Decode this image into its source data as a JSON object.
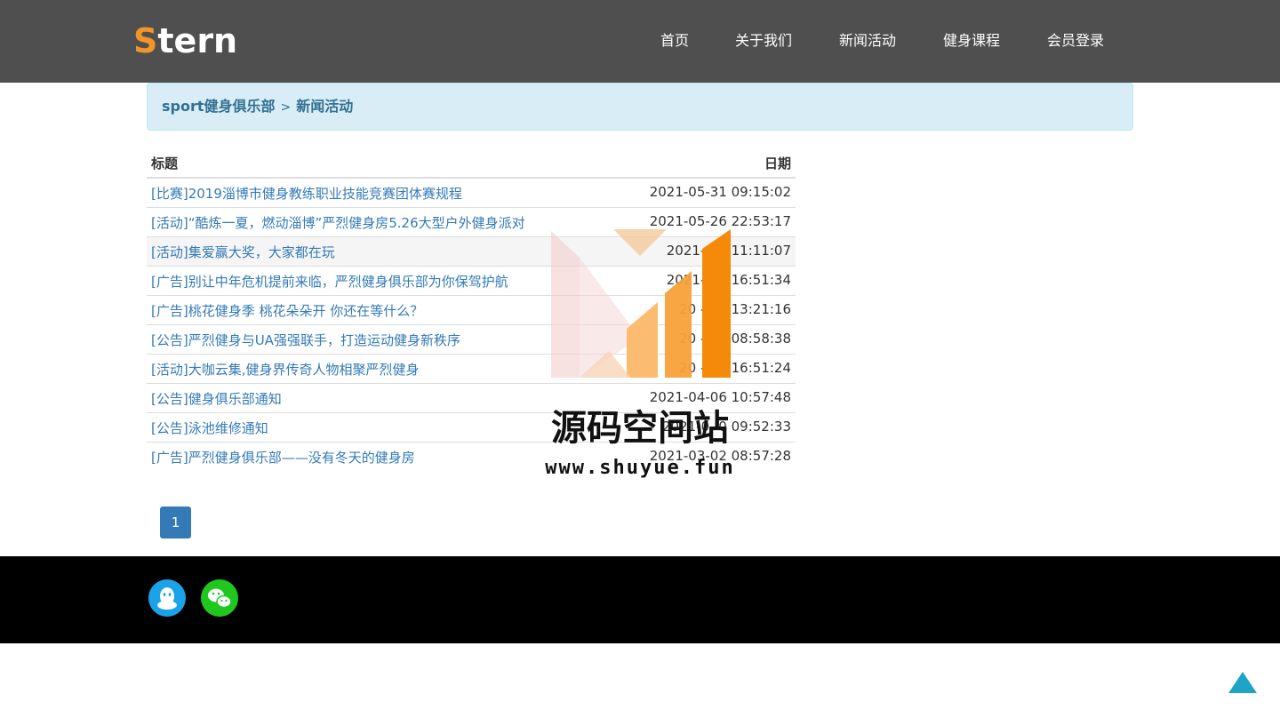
{
  "header": {
    "logo_first": "S",
    "logo_rest": "tern",
    "nav": [
      {
        "label": "首页"
      },
      {
        "label": "关于我们"
      },
      {
        "label": "新闻活动"
      },
      {
        "label": "健身课程"
      },
      {
        "label": "会员登录"
      }
    ]
  },
  "breadcrumb": {
    "home": "sport健身俱乐部",
    "separator": ">",
    "current": "新闻活动"
  },
  "table": {
    "headers": {
      "title": "标题",
      "date": "日期"
    },
    "rows": [
      {
        "title": "[比赛]2019淄博市健身教练职业技能竞赛团体赛规程",
        "date": "2021-05-31 09:15:02"
      },
      {
        "title": "[活动]“酷炼一夏，燃动淄博”严烈健身房5.26大型户外健身派对",
        "date": "2021-05-26 22:53:17"
      },
      {
        "title": "[活动]集爱赢大奖，大家都在玩",
        "date": "2021-05-   11:11:07"
      },
      {
        "title": "[广告]别让中年危机提前来临，严烈健身俱乐部为你保驾护航",
        "date": "2021-05-   16:51:34"
      },
      {
        "title": "[广告]桃花健身季 桃花朵朵开 你还在等什么？",
        "date": "20  -05-   13:21:16"
      },
      {
        "title": "[公告]严烈健身与UA强强联手，打造运动健身新秩序",
        "date": "20  -04-   08:58:38"
      },
      {
        "title": "[活动]大咖云集,健身界传奇人物相聚严烈健身",
        "date": "20  -04-   16:51:24"
      },
      {
        "title": "[公告]健身俱乐部通知",
        "date": "2021-04-06 10:57:48"
      },
      {
        "title": "[公告]泳池维修通知",
        "date": "2021-0 -0  09:52:33"
      },
      {
        "title": "[广告]严烈健身俱乐部——没有冬天的健身房",
        "date": "2021-03-02 08:57:28"
      }
    ]
  },
  "pagination": {
    "current": "1"
  },
  "watermark": {
    "title": "源码空间站",
    "url": "www.shuyue.fun"
  },
  "footer": {
    "icons": [
      "qq-icon",
      "wechat-icon"
    ]
  },
  "colors": {
    "header_bg": "#4f4f4f",
    "logo_accent": "#f0952a",
    "breadcrumb_bg": "#d9edf7",
    "link": "#337ab7",
    "footer_bg": "#000000",
    "back_to_top": "#1fa3c7"
  }
}
